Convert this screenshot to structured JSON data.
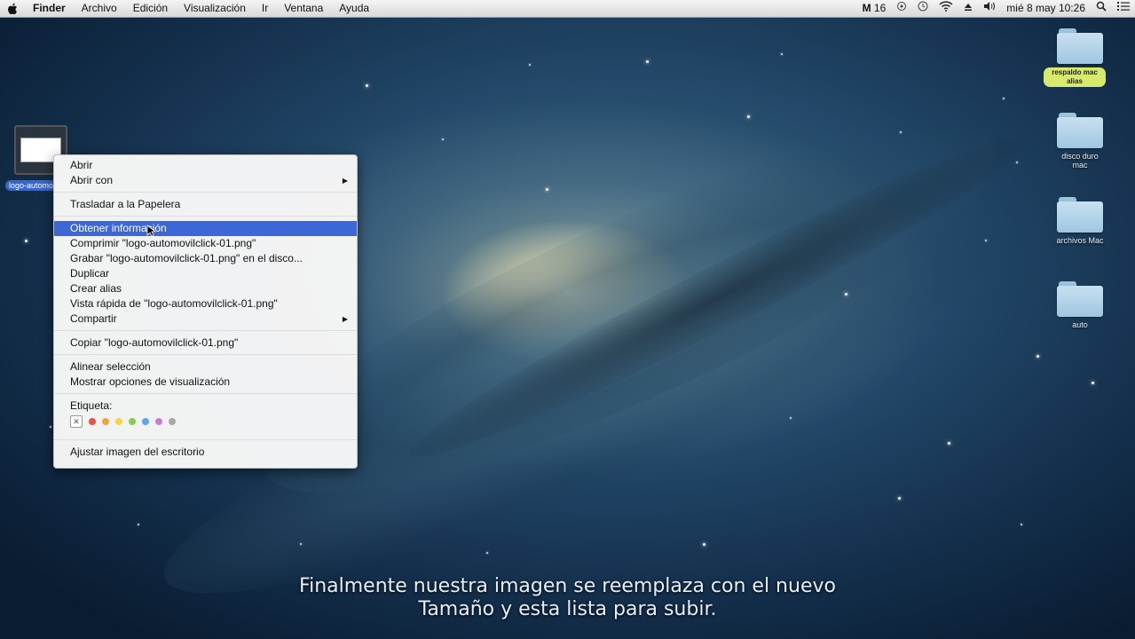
{
  "menubar": {
    "app_name": "Finder",
    "menus": [
      "Archivo",
      "Edición",
      "Visualización",
      "Ir",
      "Ventana",
      "Ayuda"
    ],
    "status": {
      "mail_count": "16",
      "clock": "mié 8 may  10:26"
    }
  },
  "desktop": {
    "folders": [
      {
        "label": "respaldo mac alias",
        "highlighted": true
      },
      {
        "label": "disco duro mac",
        "highlighted": false
      },
      {
        "label": "archivos Mac",
        "highlighted": false
      },
      {
        "label": "auto",
        "highlighted": false
      }
    ],
    "selected_file": {
      "label": "logo-automovilclick..."
    }
  },
  "context_menu": {
    "items": [
      {
        "label": "Abrir"
      },
      {
        "label": "Abrir con",
        "submenu": true
      },
      {
        "label": "Trasladar a la Papelera"
      },
      {
        "label": "Obtener información",
        "selected": true
      },
      {
        "label": "Comprimir \"logo-automovilclick-01.png\""
      },
      {
        "label": "Grabar \"logo-automovilclick-01.png\" en el disco..."
      },
      {
        "label": "Duplicar"
      },
      {
        "label": "Crear alias"
      },
      {
        "label": "Vista rápida de \"logo-automovilclick-01.png\""
      },
      {
        "label": "Compartir",
        "submenu": true
      },
      {
        "label": "Copiar \"logo-automovilclick-01.png\""
      },
      {
        "label": "Alinear selección"
      },
      {
        "label": "Mostrar opciones de visualización"
      },
      {
        "label": "Etiqueta:"
      },
      {
        "label": "Ajustar imagen del escritorio"
      }
    ],
    "tag_colors": [
      "#e8504a",
      "#f2a33a",
      "#f2d740",
      "#86cc4e",
      "#5ea7ea",
      "#c480d8",
      "#a8a8a8"
    ]
  },
  "caption": {
    "line1": "Finalmente nuestra imagen se reemplaza con el nuevo",
    "line2": "Tamaño y esta lista para subir."
  }
}
